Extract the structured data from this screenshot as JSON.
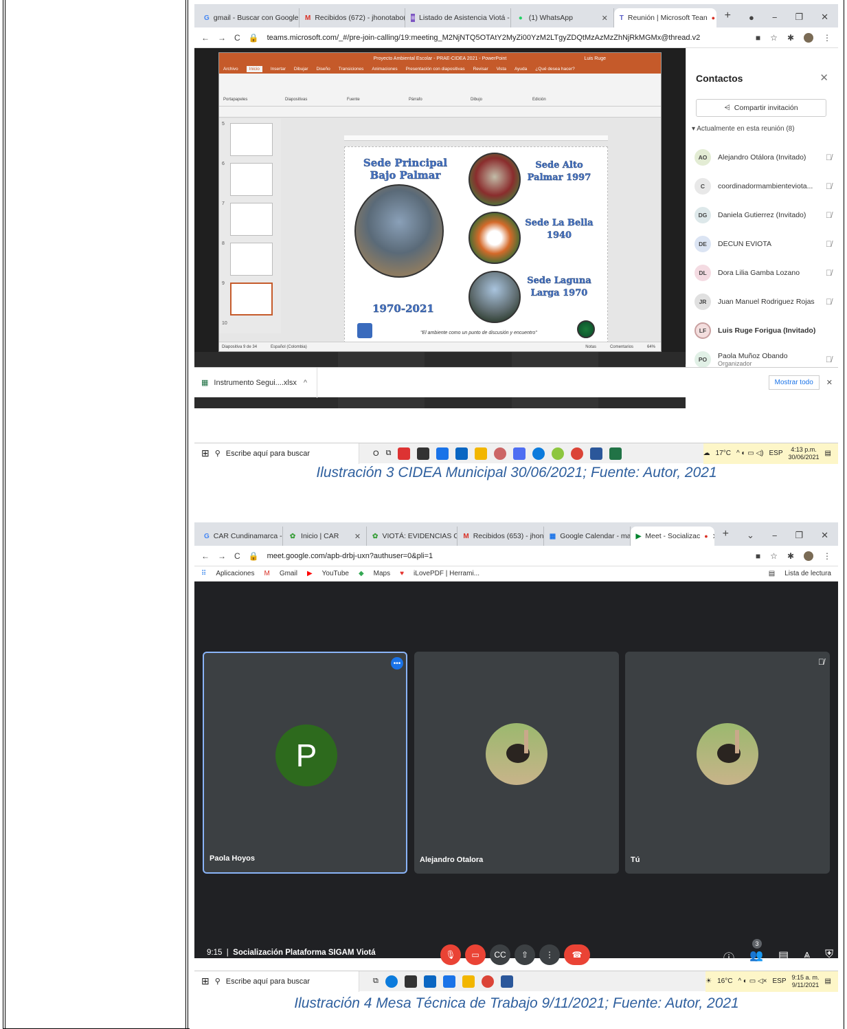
{
  "captions": {
    "fig3": "Ilustración 3 CIDEA Municipal 30/06/2021; Fuente: Autor, 2021",
    "fig4": "Ilustración 4 Mesa Técnica de Trabajo 9/11/2021; Fuente: Autor, 2021"
  },
  "teams": {
    "tabs": [
      {
        "label": "gmail - Buscar con Google",
        "icon": "G"
      },
      {
        "label": "Recibidos (672) - jhonotabo(",
        "icon": "M"
      },
      {
        "label": "Listado de Asistencia Viotá -",
        "icon": "≡"
      },
      {
        "label": "(1) WhatsApp",
        "icon": "●"
      },
      {
        "label": "Reunión | Microsoft Tean",
        "icon": "T"
      }
    ],
    "url": "teams.microsoft.com/_#/pre-join-calling/19:meeting_M2NjNTQ5OTAtY2MyZi00YzM2LTgyZDQtMzAzMzZhNjRkMGMx@thread.v2",
    "ppt": {
      "title": "Proyecto Ambiental Escolar - PRAE-CIDEA 2021 - PowerPoint",
      "user": "Luis Ruge",
      "menu": [
        "Archivo",
        "Inicio",
        "Insertar",
        "Dibujar",
        "Diseño",
        "Transiciones",
        "Animaciones",
        "Presentación con diapositivas",
        "Revisar",
        "Vista",
        "Ayuda",
        "¿Qué desea hacer?"
      ],
      "ribbon_groups": [
        "Portapapeles",
        "Diapositivas",
        "Fuente",
        "Párrafo",
        "Dibujo",
        "Edición"
      ],
      "thumb_nums": [
        "5",
        "6",
        "7",
        "8",
        "9",
        "10"
      ],
      "slide": {
        "main": "Sede Principal Bajo Palmar",
        "s1": "Sede Alto Palmar 1997",
        "s2": "Sede La Bella 1940",
        "s3": "Sede Laguna Larga 1970",
        "years": "1970-2021",
        "footer": "\"El ambiente como un punto de discusión y encuentro\""
      },
      "status": [
        "Diapositiva 9 de 34",
        "Español (Colombia)",
        "Notas",
        "Comentarios",
        "64%"
      ]
    },
    "avatars": [
      {
        "initials": "DE",
        "color": "#c7d7ef"
      },
      {
        "initials": "JR",
        "color": "#d0d0d0"
      },
      {
        "initials": "PO",
        "color": "#d6ecdf"
      },
      {
        "initials": "DG",
        "color": "#d6e3e6"
      },
      {
        "initials": "DL",
        "color": "#f2d3dc"
      },
      {
        "initials": "C",
        "color": "#e5e5e5"
      },
      {
        "initials": "LF",
        "color": "#f3d8d8"
      }
    ],
    "contacts": {
      "title": "Contactos",
      "share": "Compartir invitación",
      "section": "Actualmente en esta reunión (8)",
      "people": [
        {
          "initials": "AO",
          "name": "Alejandro Otálora (Invitado)",
          "color": "#e3ecd4",
          "bold": false,
          "sub": ""
        },
        {
          "initials": "C",
          "name": "coordinadormambienteviota...",
          "color": "#e8e8e8",
          "bold": false,
          "sub": ""
        },
        {
          "initials": "DG",
          "name": "Daniela Gutierrez (Invitado)",
          "color": "#dde8ea",
          "bold": false,
          "sub": ""
        },
        {
          "initials": "DE",
          "name": "DECUN EVIOTA",
          "color": "#dbe4f3",
          "bold": false,
          "sub": ""
        },
        {
          "initials": "DL",
          "name": "Dora Lilia Gamba Lozano",
          "color": "#f4dbe2",
          "bold": false,
          "sub": ""
        },
        {
          "initials": "JR",
          "name": "Juan Manuel Rodriguez Rojas",
          "color": "#e0e0e0",
          "bold": false,
          "sub": ""
        },
        {
          "initials": "LF",
          "name": "Luis Ruge Forigua (Invitado)",
          "color": "#f3dede",
          "bold": true,
          "sub": ""
        },
        {
          "initials": "PO",
          "name": "Paola Muñoz Obando",
          "color": "#e1f0e6",
          "bold": false,
          "sub": "Organizador"
        }
      ]
    },
    "download": {
      "file": "Instrumento Segui....xlsx",
      "show_all": "Mostrar todo"
    },
    "taskbar": {
      "search": "Escribe aquí para buscar",
      "temp": "17°C",
      "lang": "ESP",
      "time": "4:13 p.m.",
      "date": "30/06/2021"
    }
  },
  "meet": {
    "tabs": [
      {
        "label": "CAR Cundinamarca - ",
        "icon": "G"
      },
      {
        "label": "Inicio | CAR",
        "icon": "✿"
      },
      {
        "label": "VIOTÁ: EVIDENCIAS C",
        "icon": "✿"
      },
      {
        "label": "Recibidos (653) - jhon",
        "icon": "M"
      },
      {
        "label": "Google Calendar - ma",
        "icon": "▦"
      },
      {
        "label": "Meet - Socializac",
        "icon": "▶"
      }
    ],
    "url": "meet.google.com/apb-drbj-uxn?authuser=0&pli=1",
    "bookmarks": [
      "Aplicaciones",
      "Gmail",
      "YouTube",
      "Maps",
      "iLovePDF | Herrami..."
    ],
    "reading_list": "Lista de lectura",
    "participants": [
      "Paola Hoyos",
      "Alejandro Otalora",
      "Tú"
    ],
    "p_initial": "P",
    "time": "9:15",
    "meeting_name": "Socialización Plataforma SIGAM Viotá",
    "people_count": "3",
    "taskbar": {
      "search": "Escribe aquí para buscar",
      "temp": "16°C",
      "lang": "ESP",
      "time": "9:15 a. m.",
      "date": "9/11/2021"
    }
  }
}
